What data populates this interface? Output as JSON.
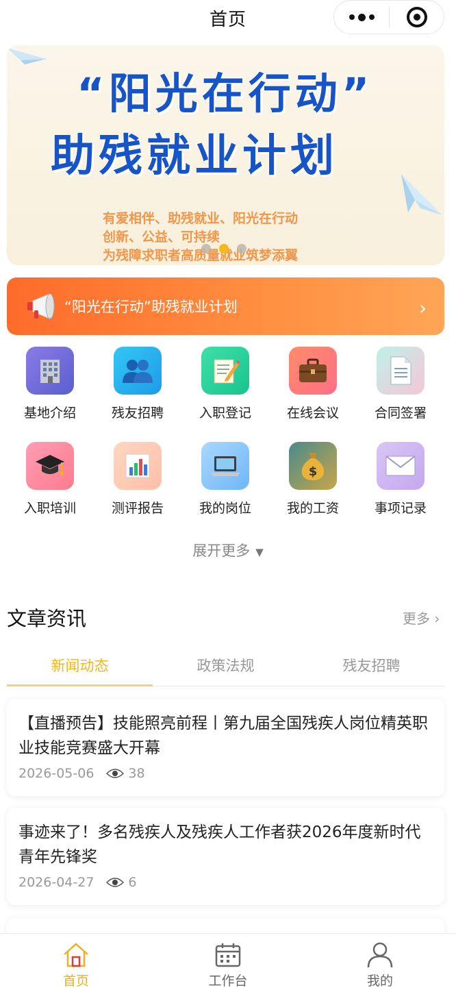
{
  "header": {
    "title": "首页"
  },
  "banner": {
    "headline_1": "“阳光在行动”",
    "headline_2": "助残就业计划",
    "subtitle_lines": [
      "有爱相伴、助残就业、阳光在行动",
      "创新、公益、可持续",
      "为残障求职者高质量就业筑梦添翼"
    ],
    "slide_count": 3,
    "active_slide": 2
  },
  "notice": {
    "text": "“阳光在行动”助残就业计划"
  },
  "menu": [
    {
      "label": "基地介绍",
      "icon": "building-icon"
    },
    {
      "label": "残友招聘",
      "icon": "people-icon"
    },
    {
      "label": "入职登记",
      "icon": "memo-pencil-icon"
    },
    {
      "label": "在线会议",
      "icon": "briefcase-icon"
    },
    {
      "label": "合同签署",
      "icon": "document-icon"
    },
    {
      "label": "入职培训",
      "icon": "graduation-cap-icon"
    },
    {
      "label": "测评报告",
      "icon": "bar-chart-icon"
    },
    {
      "label": "我的岗位",
      "icon": "laptop-icon"
    },
    {
      "label": "我的工资",
      "icon": "money-bag-icon"
    },
    {
      "label": "事项记录",
      "icon": "envelope-icon"
    }
  ],
  "expand": {
    "label": "展开更多"
  },
  "articles": {
    "title": "文章资讯",
    "more_label": "更多 ›",
    "tabs": [
      "新闻动态",
      "政策法规",
      "残友招聘"
    ],
    "active_tab": 0,
    "items": [
      {
        "title": "【直播预告】技能照亮前程丨第九届全国残疾人岗位精英职业技能竞赛盛大开幕",
        "date": "2026-05-06",
        "views": "38"
      },
      {
        "title": "事迹来了！多名残疾人及残疾人工作者获2026年度新时代青年先锋奖",
        "date": "2026-04-27",
        "views": "6"
      }
    ]
  },
  "tabbar": {
    "items": [
      {
        "label": "首页",
        "icon": "home-icon",
        "active": true
      },
      {
        "label": "工作台",
        "icon": "calendar-icon",
        "active": false
      },
      {
        "label": "我的",
        "icon": "person-icon",
        "active": false
      }
    ]
  },
  "colors": {
    "accent": "#f0ae22",
    "notice_start": "#fe6b2b",
    "notice_end": "#ffa556",
    "banner_title": "#1654c8"
  }
}
